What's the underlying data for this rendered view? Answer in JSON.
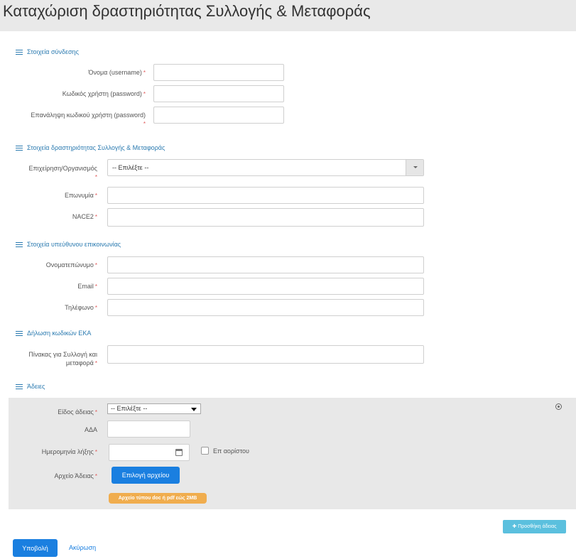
{
  "page": {
    "title": "Καταχώριση δραστηριότητας Συλλογής & Μεταφοράς"
  },
  "login_section": {
    "title": "Στοιχεία σύνδεσης",
    "username_label": "Όνομα (username)",
    "password_label": "Κωδικός χρήστη (password)",
    "password_repeat_label": "Επανάληψη κωδικού χρήστη (password)",
    "username_value": "",
    "password_value": "",
    "password_repeat_value": ""
  },
  "activity_section": {
    "title": "Στοιχεία δραστηριότητας Συλλογής & Μεταφοράς",
    "organization_label": "Επιχείρηση/Οργανισμός",
    "organization_selected": "-- Επιλέξτε --",
    "company_name_label": "Επωνυμία",
    "nace2_label": "NACE2",
    "company_name_value": "",
    "nace2_value": ""
  },
  "contact_section": {
    "title": "Στοιχεία υπεύθυνου επικοινωνίας",
    "fullname_label": "Ονοματεπώνυμο",
    "email_label": "Email",
    "phone_label": "Τηλέφωνο",
    "fullname_value": "",
    "email_value": "",
    "phone_value": ""
  },
  "eka_section": {
    "title": "Δήλωση κωδικών ΕΚΑ",
    "table_label_line1": "Πίνακας για Συλλογή και",
    "table_label_line2": "μεταφορά",
    "table_value": ""
  },
  "permits_section": {
    "title": "Άδειες",
    "type_label": "Είδος άδειας",
    "type_selected": "-- Επιλέξτε --",
    "ada_label": "ΑΔΑ",
    "ada_value": "",
    "expiry_label": "Ημερομηνία λήξης",
    "expiry_value": "",
    "indefinite_label": "Επ αορίστου",
    "indefinite_checked": false,
    "file_label": "Αρχείο Άδειας",
    "file_button": "Επιλογή αρχείου",
    "file_hint": "Αρχείο τύπου doc ή pdf εώς 2MB",
    "add_button": "Προσθήκη άδειας"
  },
  "actions": {
    "submit": "Υποβολή",
    "cancel": "Ακύρωση"
  },
  "icons": {
    "section": "bars-icon",
    "calendar": "calendar-icon",
    "remove": "remove-circle-icon",
    "add": "plus-icon"
  },
  "colors": {
    "primary": "#1a7fe0",
    "section_title": "#2a7ab0",
    "required": "#e05a5a",
    "badge": "#f0ad4e",
    "info_button": "#5bc0de",
    "header_bg": "#e9e9e9",
    "panel_bg": "#e8e8e8"
  }
}
